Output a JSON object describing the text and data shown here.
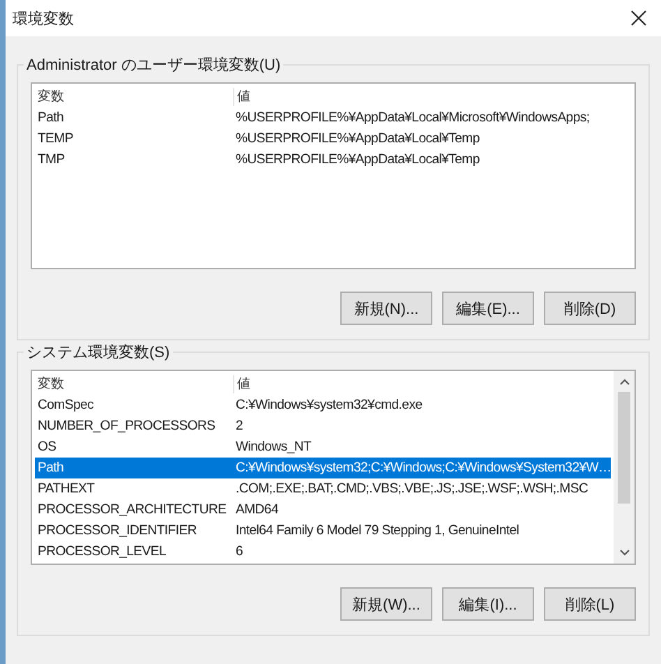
{
  "window": {
    "title": "環境変数"
  },
  "groups": [
    {
      "title": "Administrator のユーザー環境変数(U)",
      "columns": [
        "変数",
        "値"
      ],
      "scrollbar": false,
      "rows": [
        {
          "name": "Path",
          "value": "%USERPROFILE%¥AppData¥Local¥Microsoft¥WindowsApps;",
          "selected": false
        },
        {
          "name": "TEMP",
          "value": "%USERPROFILE%¥AppData¥Local¥Temp",
          "selected": false
        },
        {
          "name": "TMP",
          "value": "%USERPROFILE%¥AppData¥Local¥Temp",
          "selected": false
        }
      ],
      "buttons": [
        "新規(N)...",
        "編集(E)...",
        "削除(D)"
      ]
    },
    {
      "title": "システム環境変数(S)",
      "columns": [
        "変数",
        "値"
      ],
      "scrollbar": true,
      "rows": [
        {
          "name": "ComSpec",
          "value": "C:¥Windows¥system32¥cmd.exe",
          "selected": false
        },
        {
          "name": "NUMBER_OF_PROCESSORS",
          "value": "2",
          "selected": false
        },
        {
          "name": "OS",
          "value": "Windows_NT",
          "selected": false
        },
        {
          "name": "Path",
          "value": "C:¥Windows¥system32;C:¥Windows;C:¥Windows¥System32¥W…",
          "selected": true
        },
        {
          "name": "PATHEXT",
          "value": ".COM;.EXE;.BAT;.CMD;.VBS;.VBE;.JS;.JSE;.WSF;.WSH;.MSC",
          "selected": false
        },
        {
          "name": "PROCESSOR_ARCHITECTURE",
          "value": "AMD64",
          "selected": false
        },
        {
          "name": "PROCESSOR_IDENTIFIER",
          "value": "Intel64 Family 6 Model 79 Stepping 1, GenuineIntel",
          "selected": false
        },
        {
          "name": "PROCESSOR_LEVEL",
          "value": "6",
          "selected": false
        }
      ],
      "buttons": [
        "新規(W)...",
        "編集(I)...",
        "削除(L)"
      ]
    }
  ]
}
